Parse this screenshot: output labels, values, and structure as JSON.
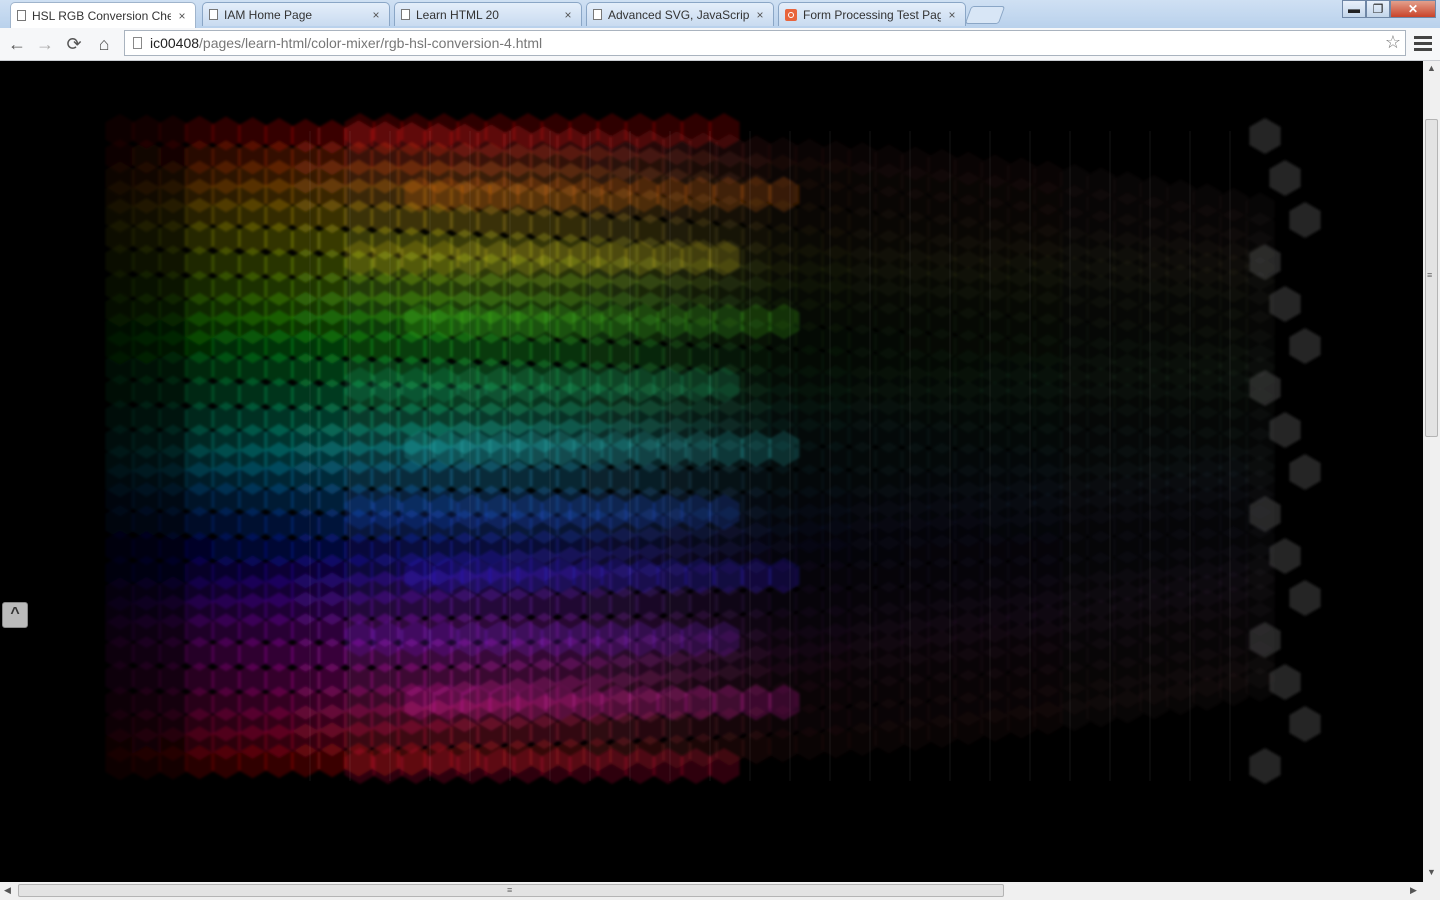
{
  "tabs": [
    {
      "label": "HSL RGB Conversion Chec",
      "active": true,
      "icon": "page-icon"
    },
    {
      "label": "IAM Home Page",
      "active": false,
      "icon": "page-icon"
    },
    {
      "label": "Learn HTML 20",
      "active": false,
      "icon": "page-icon"
    },
    {
      "label": "Advanced SVG, JavaScript",
      "active": false,
      "icon": "page-icon"
    },
    {
      "label": "Form Processing Test Pag",
      "active": false,
      "icon": "xampp-icon"
    }
  ],
  "tab_close_glyph": "×",
  "window_controls": {
    "minimize": "▬",
    "maximize": "❐",
    "close": "✕"
  },
  "toolbar": {
    "back_icon": "←",
    "forward_icon": "→",
    "reload_icon": "⟳",
    "home_icon": "⌂",
    "bookmark_icon": "☆"
  },
  "address": {
    "host": "ic00408",
    "path": "/pages/learn-html/color-mixer/rgb-hsl-conversion-4.html"
  },
  "side_widget": {
    "glyph": "^"
  },
  "scrollbars": {
    "vertical_position": 0.07,
    "horizontal_position": 0.0,
    "up_arrow": "▲",
    "down_arrow": "▼",
    "left_arrow": "◀",
    "right_arrow": "▶",
    "grip": "≡"
  },
  "colors": {
    "page_background": "#000000",
    "bands": [
      "#ff1010",
      "#ff7a10",
      "#f2e020",
      "#50e020",
      "#20c080",
      "#30d0d0",
      "#2060ff",
      "#3020ff",
      "#9020ff",
      "#ff20d0",
      "#ff1040"
    ]
  }
}
